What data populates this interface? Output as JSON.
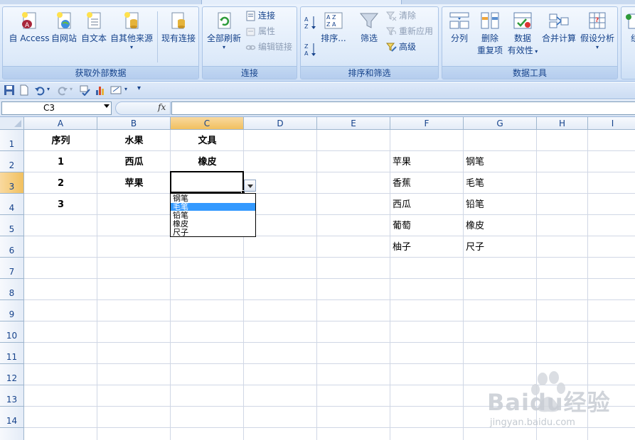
{
  "ribbon": {
    "groups": [
      {
        "label": "获取外部数据"
      },
      {
        "label": "连接"
      },
      {
        "label": "排序和筛选"
      },
      {
        "label": "数据工具"
      }
    ],
    "get_external": {
      "access": "自 Access",
      "web": "自网站",
      "text": "自文本",
      "other": "自其他来源",
      "existing": "现有连接"
    },
    "connections": {
      "refresh_all": "全部刷新",
      "connections": "连接",
      "properties": "属性",
      "edit_links": "编辑链接"
    },
    "sort_filter": {
      "sort": "排序...",
      "filter": "筛选",
      "clear": "清除",
      "reapply": "重新应用",
      "advanced": "高级"
    },
    "data_tools": {
      "text_to_columns": "分列",
      "remove_dup_1": "删除",
      "remove_dup_2": "重复项",
      "validation_1": "数据",
      "validation_2": "有效性",
      "consolidate": "合并计算",
      "what_if": "假设分析",
      "next_partial": "组"
    }
  },
  "formula_bar": {
    "name_box": "C3",
    "fx": "fx",
    "formula": ""
  },
  "grid": {
    "columns": [
      "A",
      "B",
      "C",
      "D",
      "E",
      "F",
      "G",
      "H",
      "I"
    ],
    "rows": [
      "1",
      "2",
      "3",
      "4",
      "5",
      "6",
      "7",
      "8",
      "9",
      "10",
      "11",
      "12",
      "13",
      "14"
    ],
    "headers": {
      "a1": "序列",
      "b1": "水果",
      "c1": "文具"
    },
    "row2": {
      "a": "1",
      "b": "西瓜",
      "c": "橡皮"
    },
    "row3": {
      "a": "2",
      "b": "苹果"
    },
    "row4": {
      "a": "3"
    },
    "f_list": [
      "苹果",
      "香蕉",
      "西瓜",
      "葡萄",
      "柚子"
    ],
    "g_list": [
      "钢笔",
      "毛笔",
      "铅笔",
      "橡皮",
      "尺子"
    ],
    "active_cell": "C3"
  },
  "dropdown": {
    "items": [
      "钢笔",
      "毛笔",
      "铅笔",
      "橡皮",
      "尺子"
    ],
    "highlighted": "毛笔"
  },
  "watermark": {
    "brand": "Baidu经验",
    "url": "jingyan.baidu.com"
  }
}
